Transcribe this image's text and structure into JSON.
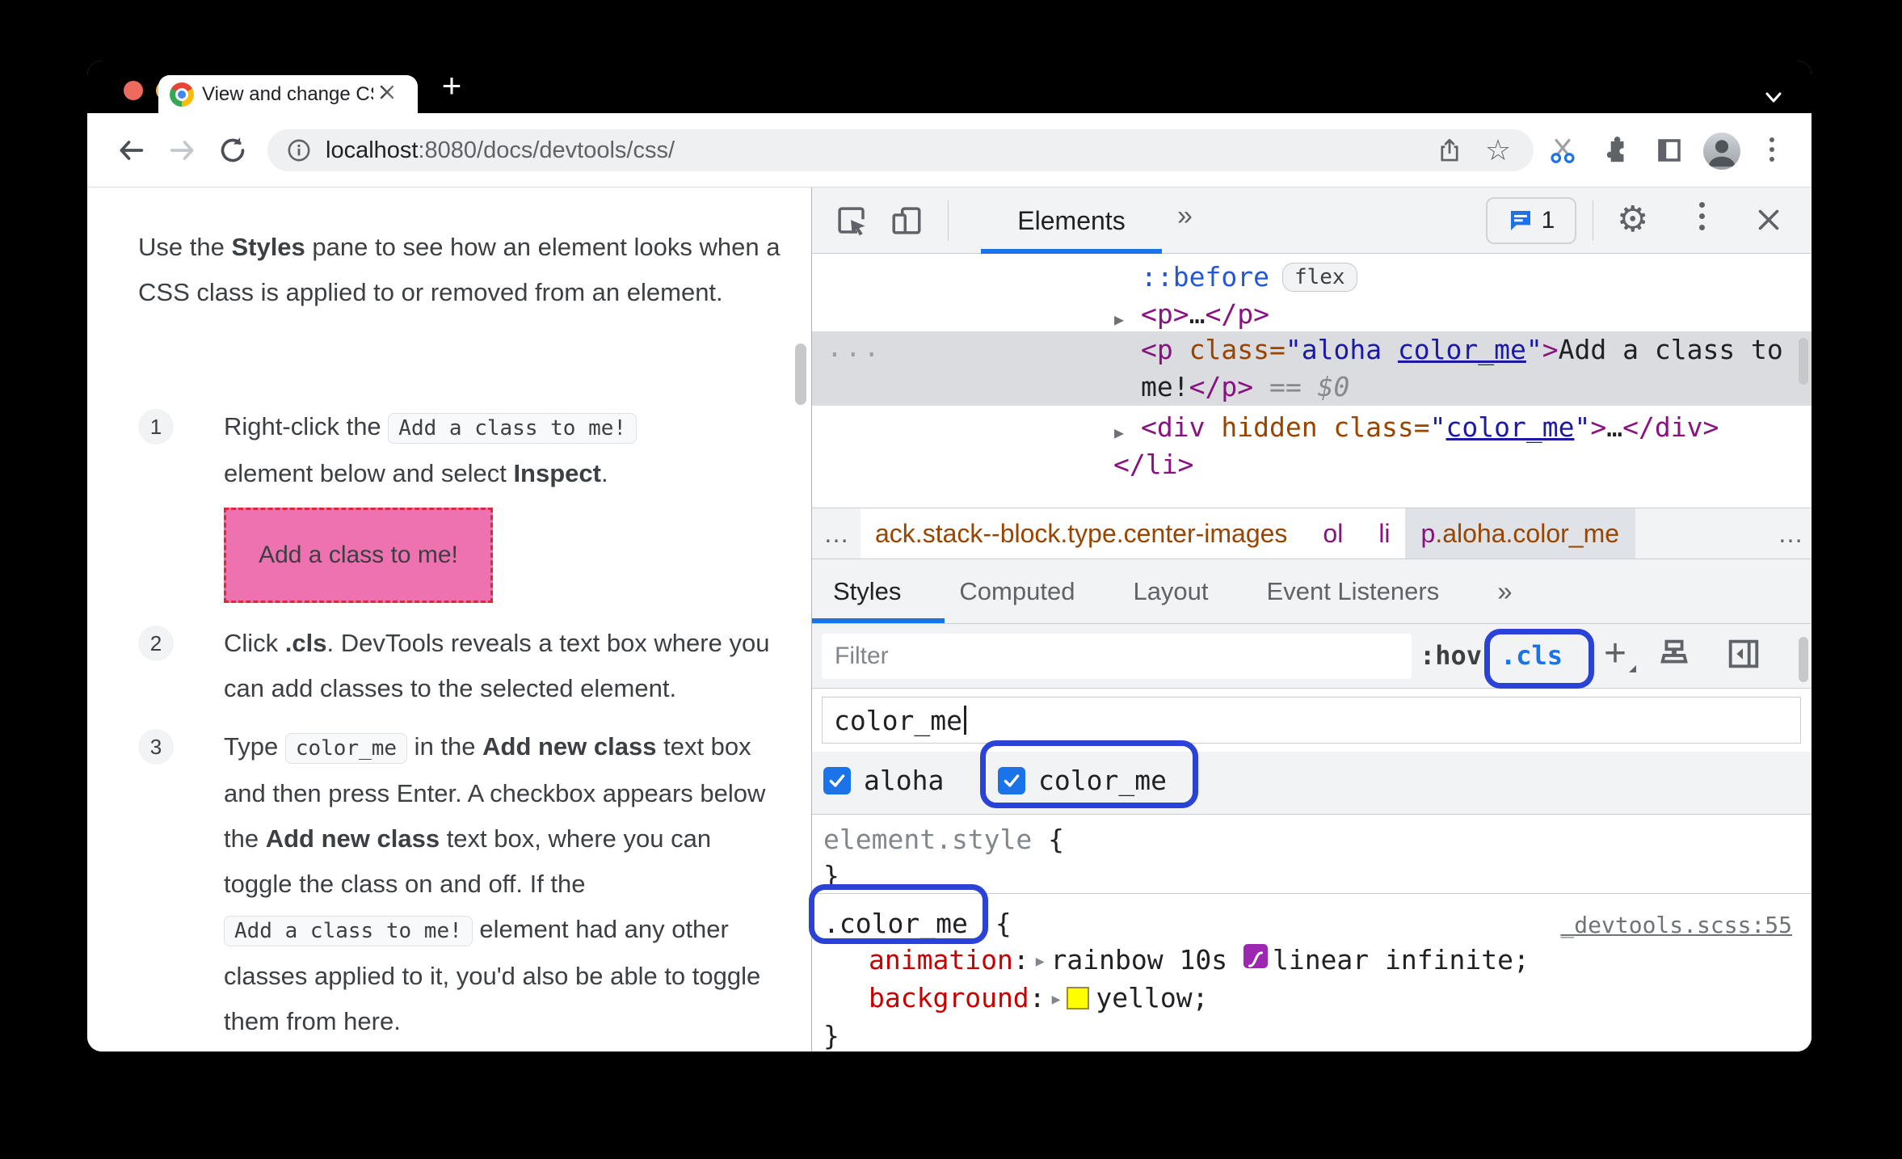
{
  "colors": {
    "annotation_blue": "#2a43d6",
    "accent_blue": "#1a73e8",
    "demo_pink_bg": "#ee72b0",
    "demo_border_red": "#e0283a",
    "property_red": "#c80000",
    "tag_purple": "#881280",
    "attr_orange": "#994500",
    "value_blue": "#1a1aa6",
    "pseudo_blue": "#2756d3",
    "swatch_yellow": "#ffff00",
    "swatch_purple": "#9c27b0",
    "traffic_red": "#ed6a5e",
    "traffic_yellow": "#f5bf4f",
    "traffic_green": "#61c554"
  },
  "browser": {
    "tab_title": "View and change CSS - Chrome",
    "new_tab_label": "+",
    "url_host": "localhost",
    "url_rest": ":8080/docs/devtools/css/"
  },
  "doc": {
    "intro_pre": "Use the ",
    "intro_bold": "Styles",
    "intro_post": " pane to see how an element looks when a CSS class is applied to or removed from an element.",
    "step1_num": "1",
    "step1_pre": "Right-click the ",
    "step1_code": "Add a class to me!",
    "step1_mid": "element below and select ",
    "step1_bold": "Inspect",
    "step1_post": ".",
    "demo_text": "Add a class to me!",
    "step2_num": "2",
    "step2_pre": "Click ",
    "step2_bold": ".cls",
    "step2_post": ". DevTools reveals a text box where you can add classes to the selected element.",
    "step3_num": "3",
    "step3_s1": "Type ",
    "step3_code1": "color_me",
    "step3_s2": " in the ",
    "step3_b1": "Add new class",
    "step3_s3": " text box and then press Enter. A checkbox appears below the ",
    "step3_b2": "Add new class",
    "step3_s4": " text box, where you can toggle the class on and off. If the ",
    "step3_code2": "Add a class to me!",
    "step3_s5": " element had any other classes applied to it, you'd also be able to toggle them from here."
  },
  "devtools": {
    "panel_tab": "Elements",
    "more_tabs": "»",
    "badge_count": "1",
    "dom": {
      "pseudo": "::before",
      "flex_badge": "flex",
      "r2_open": "<p>",
      "r2_dots": "…",
      "r2_close": "</p>",
      "sel_dots": "...",
      "sel_tag": "<p",
      "sel_attr": " class",
      "sel_eq": "=",
      "sel_q": "\"",
      "sel_v1": "aloha ",
      "sel_v2": "color_me",
      "sel_gt": ">",
      "sel_text1": "Add a class to",
      "sel_text2": "me!",
      "sel_close": "</p>",
      "sel_sep": " == ",
      "sel_dollar": "$0",
      "r4_tag": "<div",
      "r4_attr1": " hidden",
      "r4_attr2": " class",
      "r4_eq": "=",
      "r4_q": "\"",
      "r4_v": "color_me",
      "r4_gt": ">",
      "r4_dots": "…",
      "r4_close": "</div>",
      "r5": "</li>"
    },
    "crumbs": {
      "lead": "…",
      "c1": "ack.stack--block.type.center-images",
      "c2": "ol",
      "c3": "li",
      "c4_tag": "p",
      "c4_classes": ".aloha.color_me",
      "trail": "…"
    },
    "tabs": {
      "t1": "Styles",
      "t2": "Computed",
      "t3": "Layout",
      "t4": "Event Listeners",
      "more": "»"
    },
    "filter_placeholder": "Filter",
    "hov_label": ":hov",
    "cls_label": ".cls",
    "class_input_value": "color_me",
    "check1": "aloha",
    "check2": "color_me",
    "inline_style": {
      "selector": "element.style",
      "open": "{",
      "close": "}"
    },
    "rule": {
      "selector": ".color_me",
      "open": "{",
      "source": "_devtools.scss:55",
      "p1": "animation",
      "p1v1": "rainbow 10s",
      "p1v2": "linear infinite;",
      "p2": "background",
      "p2v": "yellow;",
      "close": "}"
    }
  }
}
